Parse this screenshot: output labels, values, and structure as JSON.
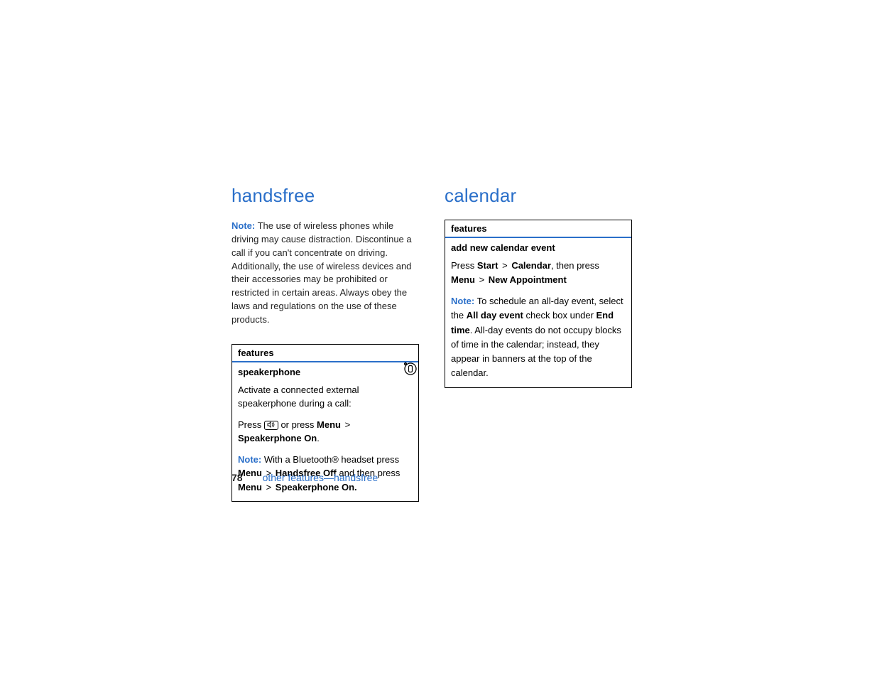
{
  "left": {
    "heading": "handsfree",
    "intro": {
      "noteLabel": "Note:",
      "text": " The use of wireless phones while driving may cause distraction. Discontinue a call if you can't concentrate on driving. Additionally, the use of wireless devices and their accessories may be prohibited or restricted in certain areas. Always obey the laws and regulations on the use of these products."
    },
    "box": {
      "header": "features",
      "sectionTitle": "speakerphone",
      "line1": "Activate a connected external speakerphone during a call:",
      "line2a": "Press ",
      "line2b": " or press ",
      "menu1": "Menu",
      "sep": ">",
      "spkOn": "Speakerphone On",
      "period": ".",
      "note2Label": "Note:",
      "note2a": " With a Bluetooth® headset press ",
      "menu2": "Menu",
      "handsfreeOff": "Handsfree Off",
      "note2b": " and then press ",
      "menu3": "Menu",
      "spkOn2": "Speakerphone On."
    }
  },
  "right": {
    "heading": "calendar",
    "box": {
      "header": "features",
      "sectionTitle": "add new calendar event",
      "line1a": "Press ",
      "start": "Start",
      "sep": ">",
      "calendar": "Calendar",
      "line1b": ", then press ",
      "menu": "Menu",
      "newAppt": "New Appointment",
      "noteLabel": "Note:",
      "note1a": " To schedule an all-day event, select the ",
      "allDay": "All day event",
      "note1b": " check box under ",
      "endTime": "End time",
      "note1c": ". All-day events do not occupy blocks of time in the calendar; instead, they appear in banners at the top of the calendar."
    }
  },
  "footer": {
    "pageNum": "78",
    "text": "other features—handsfree"
  }
}
